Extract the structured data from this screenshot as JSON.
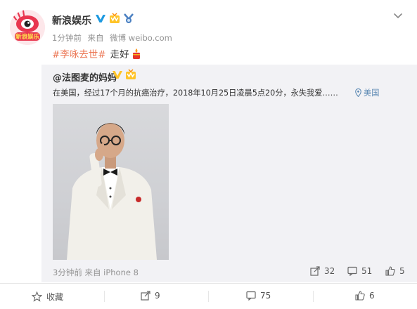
{
  "post": {
    "author": "新浪娱乐",
    "avatar_text": "新浪娱乐",
    "meta": {
      "time": "1分钟前",
      "source_prefix": "来自",
      "source": "微博 weibo.com"
    },
    "text": {
      "hashtag": "#李咏去世#",
      "body": "走好"
    }
  },
  "repost": {
    "author": "@法图麦的妈妈",
    "text": "在美国，经过17个月的抗癌治疗，2018年10月25日凌晨5点20分，永失我爱……",
    "location": "美国",
    "footer": {
      "time": "3分钟前",
      "source_prefix": "来自",
      "source": "iPhone 8"
    },
    "counts": {
      "forward": "32",
      "comment": "51",
      "like": "5"
    }
  },
  "actions": {
    "favorite_label": "收藏",
    "forward_count": "9",
    "comment_count": "75",
    "like_count": "6"
  },
  "colors": {
    "hashtag": "#eb7350",
    "location": "#5d8ab4",
    "repost_bg": "#f2f2f5",
    "meta_gray": "#939393",
    "verified_badge": "#ffc428"
  },
  "icons": [
    "chevron-down-icon",
    "verified-v-icon",
    "vip-crown-icon",
    "candle-emoji-icon",
    "location-pin-icon",
    "forward-icon",
    "comment-icon",
    "like-icon",
    "favorite-star-icon"
  ]
}
